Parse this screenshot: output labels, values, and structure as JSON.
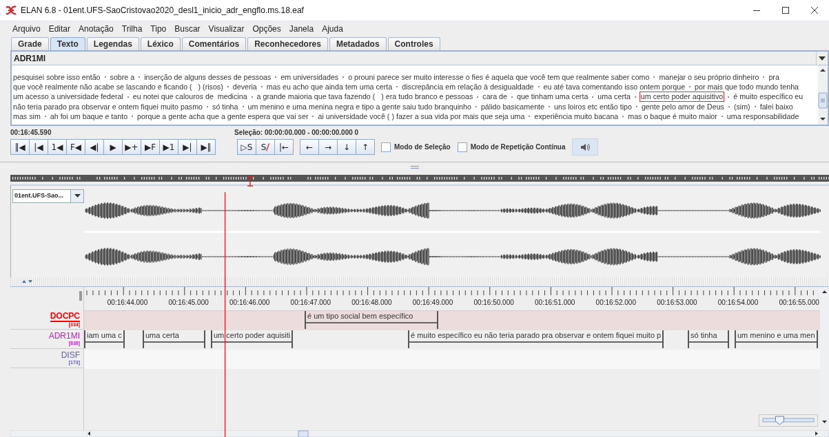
{
  "window": {
    "title": "ELAN 6.8 - 01ent.UFS-SaoCristovao2020_desl1_inicio_adr_engflo.ms.18.eaf"
  },
  "menu": [
    {
      "label": "Arquivo"
    },
    {
      "label": "Editar"
    },
    {
      "label": "Anotação"
    },
    {
      "label": "Trilha"
    },
    {
      "label": "Tipo"
    },
    {
      "label": "Buscar"
    },
    {
      "label": "Visualizar"
    },
    {
      "label": "Opções"
    },
    {
      "label": "Janela"
    },
    {
      "label": "Ajuda"
    }
  ],
  "tabs": [
    {
      "label": "Grade",
      "selected": false
    },
    {
      "label": "Texto",
      "selected": true
    },
    {
      "label": "Legendas",
      "selected": false
    },
    {
      "label": "Léxico",
      "selected": false
    },
    {
      "label": "Comentários",
      "selected": false
    },
    {
      "label": "Reconhecedores",
      "selected": false
    },
    {
      "label": "Metadados",
      "selected": false
    },
    {
      "label": "Controles",
      "selected": false
    }
  ],
  "text_view": {
    "tier": "ADR1MI",
    "lines": [
      [
        {
          "text": "pesquisei sobre isso então",
          "selected": false
        },
        {
          "text": "sobre a",
          "selected": false
        },
        {
          "text": "inserção de alguns desses de pessoas",
          "selected": false
        },
        {
          "text": "em universidades",
          "selected": false
        },
        {
          "text": "o prouni parece ser muito interesse o fies é aquela que você tem que realmente saber como",
          "selected": false
        },
        {
          "text": "manejar o seu próprio dinheiro",
          "selected": false
        },
        {
          "text": "pra",
          "selected": false
        }
      ],
      [
        {
          "text": "que você realmente não acabe se lascando e ficando (   ) (risos)",
          "selected": false
        },
        {
          "text": "deveria",
          "selected": false
        },
        {
          "text": "mas eu acho que ainda tem uma certa",
          "selected": false
        },
        {
          "text": "discrepância em relação à desigualdade",
          "selected": false
        },
        {
          "text": "eu até tava comentando isso ontem porque",
          "selected": false
        },
        {
          "text": "por mais que todo mundo tenha",
          "selected": false
        }
      ],
      [
        {
          "text": "um acesso a universidade federal",
          "selected": false
        },
        {
          "text": "eu notei que calouros de  medicina",
          "selected": false
        },
        {
          "text": "a grande maioria que tava fazendo (   ) era tudo branco e pessoas",
          "selected": false
        },
        {
          "text": "cara de",
          "selected": false
        },
        {
          "text": "que tinham uma certa",
          "selected": false
        },
        {
          "text": "uma certa",
          "selected": false
        },
        {
          "text": "um certo poder aquisitivo",
          "selected": true
        },
        {
          "text": "é muito específico eu",
          "selected": false
        }
      ],
      [
        {
          "text": "não teria parado pra observar e ontem fiquei muito pasmo",
          "selected": false
        },
        {
          "text": "só tinha",
          "selected": false
        },
        {
          "text": "um menino e uma menina negra e tipo a gente saiu tudo branquinho",
          "selected": false
        },
        {
          "text": "pálido basicamente",
          "selected": false
        },
        {
          "text": "uns loiros etc então tipo",
          "selected": false
        },
        {
          "text": "gente pelo amor de Deus",
          "selected": false
        },
        {
          "text": "(sim)",
          "selected": false
        },
        {
          "text": "falei baixo",
          "selected": false
        }
      ],
      [
        {
          "text": "mas sim",
          "selected": false
        },
        {
          "text": "ah foi um baque e tanto",
          "selected": false
        },
        {
          "text": "porque a gente acha que a gente espera que vai ser",
          "selected": false
        },
        {
          "text": "ai universidade você ( ) fazer a sua vida por mais que seja uma",
          "selected": false
        },
        {
          "text": "experiência muito bacana",
          "selected": false
        },
        {
          "text": "mas o baque é muito maior",
          "selected": false
        },
        {
          "text": "uma responsabilidade",
          "selected": false
        }
      ]
    ]
  },
  "player": {
    "time": "00:16:45.590",
    "selection": "Seleção: 00:00:00.000 - 00:00:00.000  0",
    "media_buttons": [
      "‖◀",
      "|◀",
      "1◀",
      "F◀",
      "◀|",
      "▶",
      "▶+",
      "▶F",
      "▶1",
      "▶|",
      "▶‖"
    ],
    "selection_buttons": [
      {
        "glyph": "▷S",
        "kind": "plain"
      },
      {
        "glyph": "S",
        "kind": "crossed"
      },
      {
        "glyph": "|←",
        "kind": "plain"
      }
    ],
    "arrow_buttons": [
      "←",
      "→",
      "↓",
      "↑"
    ],
    "options": [
      {
        "label": "Modo de Seleção",
        "checked": false
      },
      {
        "label": "Modo de Repetição Contínua",
        "checked": false
      }
    ]
  },
  "waveform": {
    "media": "01ent.UFS-Sao..."
  },
  "timeline": {
    "ticks": [
      "00:16:44.000",
      "00:16:45.000",
      "00:16:46.000",
      "00:16:47.000",
      "00:16:48.000",
      "00:16:49.000",
      "00:16:50.000",
      "00:16:51.000",
      "00:16:52.000",
      "00:16:53.000",
      "00:16:54.000",
      "00:16:55.000"
    ],
    "tiers": [
      {
        "name": "DOCPC",
        "count": "[334]",
        "color": "#ff0000",
        "active": true,
        "annotations": [
          "é um tipo social bem específico"
        ]
      },
      {
        "name": "ADR1MI",
        "count": "[838]",
        "color": "#c020c0",
        "active": false,
        "annotations": [
          "iam uma c",
          "uma certa",
          "um certo poder aquisiti",
          "é muito específico eu não teria parado pra observar e ontem fiquei muito p",
          "só tinha",
          "um menino e uma men"
        ]
      },
      {
        "name": "DISF",
        "count": "[173]",
        "color": "#6060a8",
        "active": false
      }
    ]
  },
  "zoom_slider": {
    "level": 0.33
  }
}
